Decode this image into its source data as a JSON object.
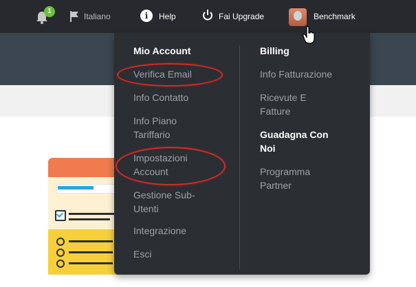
{
  "topbar": {
    "notification_count": "1",
    "language": "Italiano",
    "help": "Help",
    "upgrade": "Fai Upgrade",
    "account_name": "Benchmark"
  },
  "dropdown": {
    "left_column": {
      "heading": "Mio Account",
      "items": [
        "Verifica Email",
        "Info Contatto",
        "Info Piano\nTariffario",
        "Impostazioni\nAccount",
        "Gestione Sub-\nUtenti",
        "Integrazione",
        "Esci"
      ]
    },
    "right_column": {
      "billing_heading": "Billing",
      "billing_items": [
        "Info Fatturazione",
        "Ricevute E\nFatture"
      ],
      "earn_heading": "Guadagna Con\nNoi",
      "earn_items": [
        "Programma\nPartner"
      ]
    }
  },
  "highlights": [
    "Verifica Email",
    "Impostazioni Account"
  ],
  "colors": {
    "topbar": "#27292e",
    "dropdown": "#2b2e33",
    "highlight": "#d52a2a",
    "badge": "#6bbf3a"
  }
}
